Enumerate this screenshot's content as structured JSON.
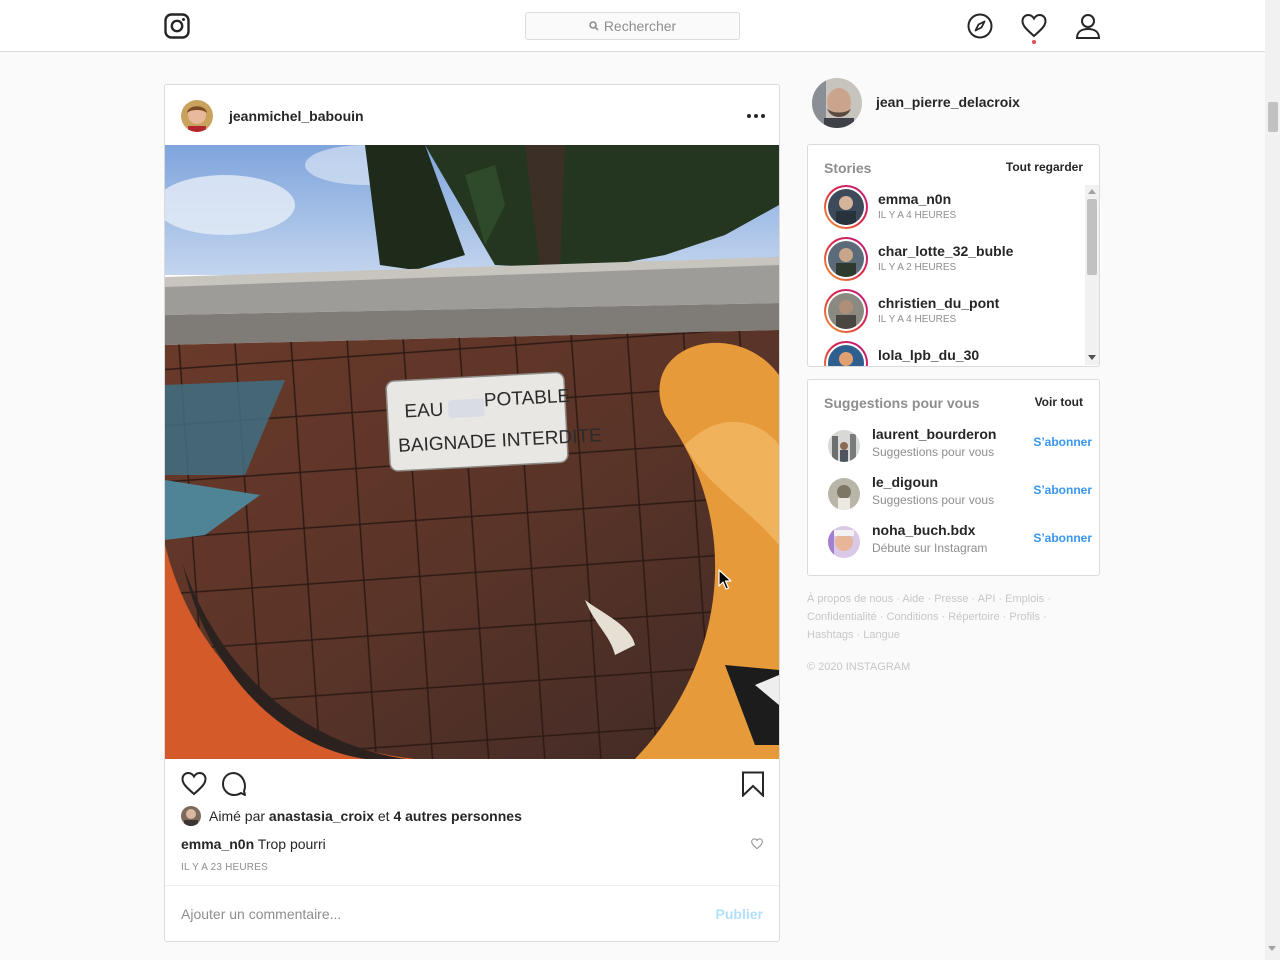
{
  "header": {
    "logo_icon": "instagram-icon",
    "search_placeholder": "Rechercher",
    "nav_icons": [
      "compass-icon",
      "heart-icon",
      "profile-icon"
    ]
  },
  "post": {
    "username": "jeanmichel_babouin",
    "image_sign": {
      "line1_left": "EAU",
      "line1_right": "POTABLE",
      "line2": "BAIGNADE INTERDITE"
    },
    "liked_prefix": "Aimé par",
    "liked_user": "anastasia_croix",
    "liked_and": "et",
    "liked_others": "4 autres personnes",
    "comment_user": "emma_n0n",
    "comment_text": "Trop pourri",
    "timestamp": "IL Y A 23 HEURES",
    "comment_placeholder": "Ajouter un commentaire...",
    "publish_label": "Publier"
  },
  "sidebar": {
    "me_username": "jean_pierre_delacroix",
    "stories_title": "Stories",
    "stories_link": "Tout regarder",
    "stories": [
      {
        "name": "emma_n0n",
        "time": "IL Y A 4 HEURES"
      },
      {
        "name": "char_lotte_32_buble",
        "time": "IL Y A 2 HEURES"
      },
      {
        "name": "christien_du_pont",
        "time": "IL Y A 4 HEURES"
      },
      {
        "name": "lola_lpb_du_30",
        "time": ""
      }
    ],
    "suggestions_title": "Suggestions pour vous",
    "suggestions_link": "Voir tout",
    "suggestions": [
      {
        "name": "laurent_bourderon",
        "sub": "Suggestions pour vous",
        "action": "S’abonner"
      },
      {
        "name": "le_digoun",
        "sub": "Suggestions pour vous",
        "action": "S’abonner"
      },
      {
        "name": "noha_buch.bdx",
        "sub": "Débute sur Instagram",
        "action": "S’abonner"
      }
    ],
    "footer_links": [
      "À propos de nous",
      "Aide",
      "Presse",
      "API",
      "Emplois",
      "Confidentialité",
      "Conditions",
      "Répertoire",
      "Profils",
      "Hashtags",
      "Langue"
    ],
    "copyright": "© 2020 INSTAGRAM"
  }
}
